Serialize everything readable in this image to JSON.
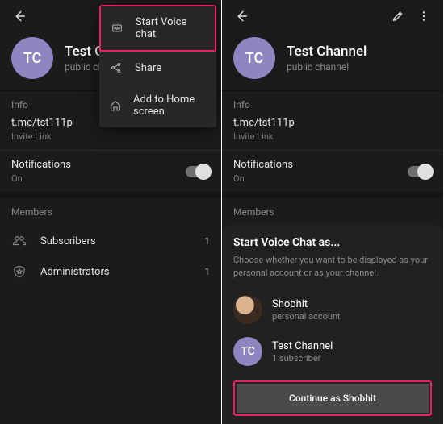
{
  "channel": {
    "title": "Test Channel",
    "subtitle": "public channel",
    "initials": "TC"
  },
  "info": {
    "header": "Info",
    "link": "t.me/tst111p",
    "linkLabel": "Invite Link"
  },
  "notif": {
    "label": "Notifications",
    "state": "On"
  },
  "members": {
    "header": "Members",
    "subs": {
      "label": "Subscribers",
      "count": "1"
    },
    "admins": {
      "label": "Administrators",
      "count": "1"
    }
  },
  "menu": {
    "voice": "Start Voice chat",
    "share": "Share",
    "home": "Add to Home screen"
  },
  "sheet": {
    "title": "Start Voice Chat as...",
    "desc": "Choose whether you want to be displayed as your personal account or as your channel.",
    "opt1": {
      "name": "Shobhit",
      "sub": "personal account"
    },
    "opt2": {
      "name": "Test Channel",
      "sub": "1 subscriber"
    },
    "cta": "Continue as Shobhit"
  }
}
